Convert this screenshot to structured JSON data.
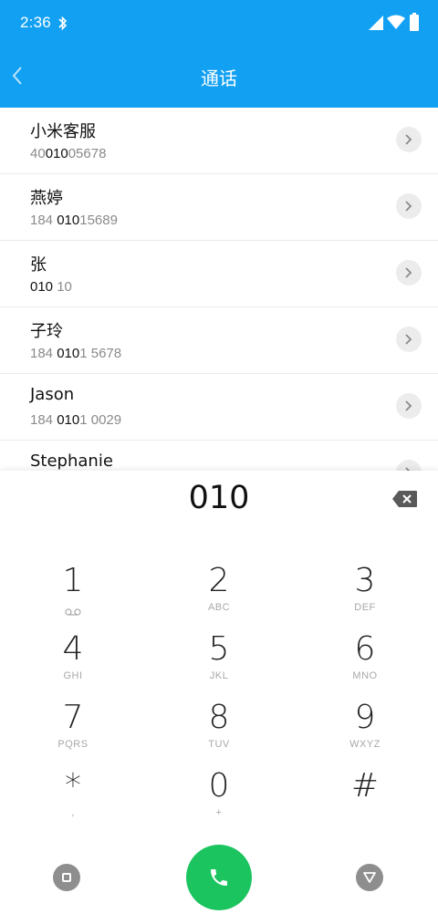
{
  "status_bar": {
    "time": "2:36",
    "icons": [
      "bluetooth-icon",
      "signal-icon",
      "wifi-icon",
      "battery-icon"
    ]
  },
  "header": {
    "title": "通话",
    "back_icon": "chevron-left-icon"
  },
  "contacts": [
    {
      "name": "小米客服",
      "number_segments": [
        {
          "t": "40",
          "m": false
        },
        {
          "t": "010",
          "m": true
        },
        {
          "t": "05678",
          "m": false
        }
      ]
    },
    {
      "name": "燕婷",
      "number_segments": [
        {
          "t": "184 ",
          "m": false
        },
        {
          "t": "010",
          "m": true
        },
        {
          "t": "15689",
          "m": false
        }
      ]
    },
    {
      "name": "张",
      "number_segments": [
        {
          "t": "010",
          "m": true
        },
        {
          "t": " 10",
          "m": false
        }
      ]
    },
    {
      "name": "子玲",
      "number_segments": [
        {
          "t": "184 ",
          "m": false
        },
        {
          "t": "010",
          "m": true
        },
        {
          "t": "1 5678",
          "m": false
        }
      ]
    },
    {
      "name": "Jason",
      "number_segments": [
        {
          "t": "184 ",
          "m": false
        },
        {
          "t": "010",
          "m": true
        },
        {
          "t": "1 0029",
          "m": false
        }
      ]
    },
    {
      "name": "Stephanie",
      "number_segments": []
    }
  ],
  "dialer": {
    "input_value": "010",
    "keys": [
      {
        "digit": "1",
        "letters": "",
        "icon": "voicemail-icon"
      },
      {
        "digit": "2",
        "letters": "ABC"
      },
      {
        "digit": "3",
        "letters": "DEF"
      },
      {
        "digit": "4",
        "letters": "GHI"
      },
      {
        "digit": "5",
        "letters": "JKL"
      },
      {
        "digit": "6",
        "letters": "MNO"
      },
      {
        "digit": "7",
        "letters": "PQRS"
      },
      {
        "digit": "8",
        "letters": "TUV"
      },
      {
        "digit": "9",
        "letters": "WXYZ"
      },
      {
        "digit": "*",
        "letters": ","
      },
      {
        "digit": "0",
        "letters": "+"
      },
      {
        "digit": "#",
        "letters": ""
      }
    ]
  },
  "colors": {
    "header_blue": "#12A1F2",
    "call_green": "#1BC45F",
    "muted_gray": "#8e8e8e"
  }
}
